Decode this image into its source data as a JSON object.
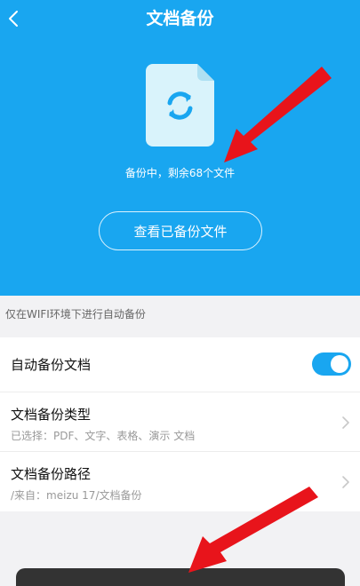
{
  "header": {
    "title": "文档备份",
    "status": "备份中，剩余68个文件",
    "view_button": "查看已备份文件"
  },
  "hint": "仅在WIFI环境下进行自动备份",
  "settings": [
    {
      "title": "自动备份文档",
      "enabled": true
    },
    {
      "title": "文档备份类型",
      "subtitle": "已选择：PDF、文字、表格、演示 文档"
    },
    {
      "title": "文档备份路径",
      "subtitle": "/来自：meizu 17/文档备份"
    }
  ],
  "colors": {
    "accent": "#19a6f0",
    "annotation": "#e8141b"
  }
}
